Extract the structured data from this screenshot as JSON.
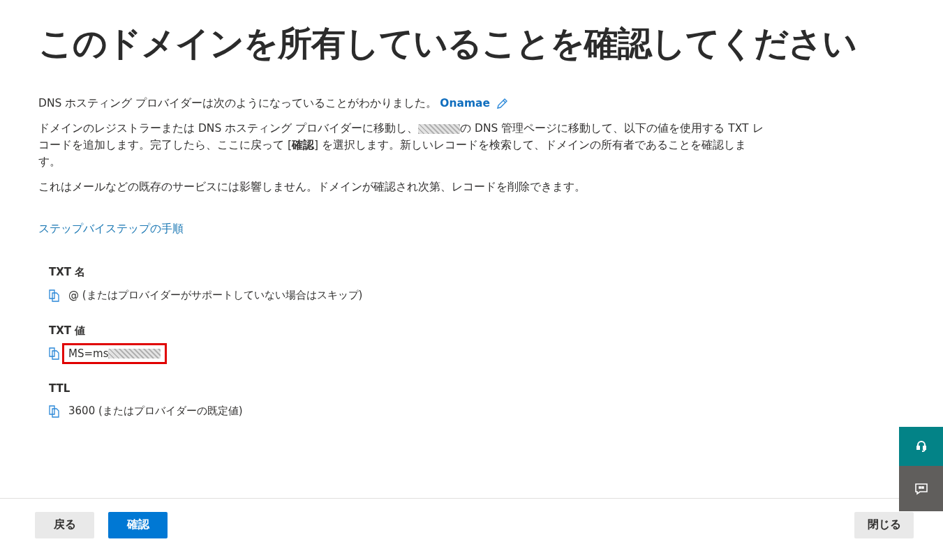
{
  "title": "このドメインを所有していることを確認してください",
  "provider": {
    "text": "DNS ホスティング プロバイダーは次のようになっていることがわかりました。",
    "name": "Onamae"
  },
  "instructions": {
    "before_domain": "ドメインのレジストラーまたは DNS ホスティング プロバイダーに移動し、",
    "after_domain": "の DNS 管理ページに移動して、以下の値を使用する TXT レコードを追加します。完了したら、ここに戻って [**確認**] を選択します。新しいレコードを検索して、ドメインの所有者であることを確認します。"
  },
  "note": "これはメールなどの既存のサービスには影響しません。ドメインが確認され次第、レコードを削除できます。",
  "help_link": "ステップバイステップの手順",
  "records": [
    {
      "label": "TXT 名",
      "value": "@ (またはプロバイダーがサポートしていない場合はスキップ)",
      "redacted": false,
      "highlighted": false
    },
    {
      "label": "TXT 値",
      "value": "MS=ms",
      "redacted": true,
      "highlighted": true
    },
    {
      "label": "TTL",
      "value": "3600 (またはプロバイダーの既定値)",
      "redacted": false,
      "highlighted": false
    }
  ],
  "footer": {
    "buttons": [
      {
        "label": "戻る",
        "kind": "secondary"
      },
      {
        "label": "確認",
        "kind": "primary"
      }
    ],
    "close": "閉じる"
  }
}
